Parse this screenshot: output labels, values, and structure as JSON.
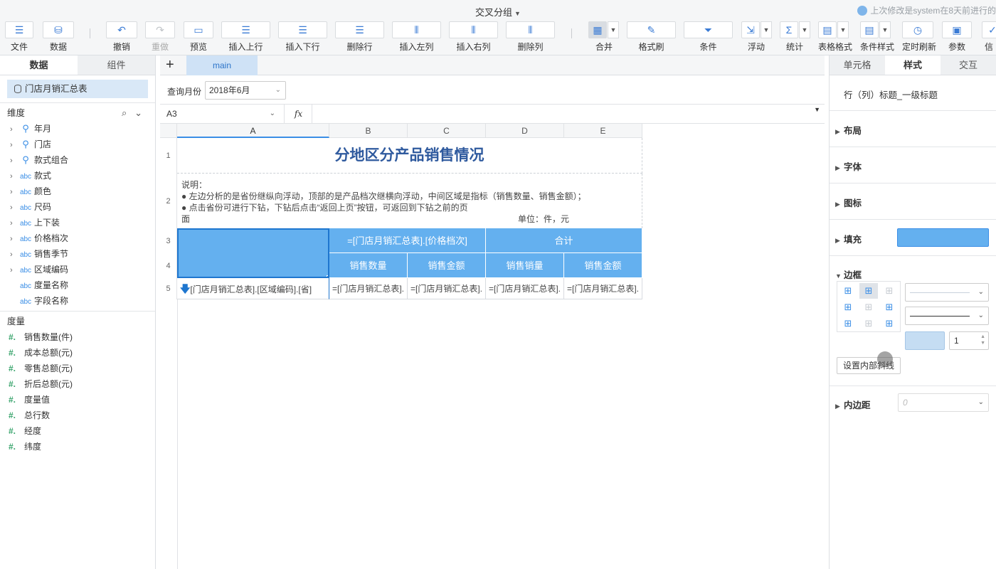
{
  "window": {
    "title": "交叉分组",
    "last_modified": "上次修改是system在8天前进行的"
  },
  "toolbar": {
    "file": "文件",
    "data": "数据",
    "undo": "撤销",
    "redo": "重做",
    "preview": "预览",
    "insert_row_above": "插入上行",
    "insert_row_below": "插入下行",
    "delete_row": "删除行",
    "insert_col_left": "插入左列",
    "insert_col_right": "插入右列",
    "delete_col": "删除列",
    "merge": "合并",
    "format_painter": "格式刷",
    "condition": "条件",
    "float": "浮动",
    "stats": "统计",
    "table_format": "表格格式",
    "cond_style": "条件样式",
    "timed_refresh": "定时刷新",
    "params": "参数",
    "more": "信"
  },
  "left_panel": {
    "tabs": [
      "数据",
      "组件"
    ],
    "dataset": "门店月销汇总表",
    "dimension_title": "维度",
    "dimensions": [
      {
        "label": "年月",
        "type": "pin"
      },
      {
        "label": "门店",
        "type": "pin"
      },
      {
        "label": "款式组合",
        "type": "pin"
      },
      {
        "label": "款式",
        "type": "abc"
      },
      {
        "label": "颜色",
        "type": "abc"
      },
      {
        "label": "尺码",
        "type": "abc"
      },
      {
        "label": "上下装",
        "type": "abc"
      },
      {
        "label": "价格档次",
        "type": "abc"
      },
      {
        "label": "销售季节",
        "type": "abc"
      },
      {
        "label": "区域编码",
        "type": "abc"
      },
      {
        "label": "度量名称",
        "type": "abc"
      },
      {
        "label": "字段名称",
        "type": "abc"
      }
    ],
    "measure_title": "度量",
    "measures": [
      "销售数量(件)",
      "成本总额(元)",
      "零售总额(元)",
      "折后总额(元)",
      "度量值",
      "总行数",
      "经度",
      "纬度"
    ]
  },
  "center": {
    "sheet_tab": "main",
    "param_label": "查询月份",
    "param_value": "2018年6月",
    "cell_ref": "A3",
    "fx": "fx",
    "columns": [
      "A",
      "B",
      "C",
      "D",
      "E"
    ],
    "rows": [
      "1",
      "2",
      "3",
      "4",
      "5"
    ],
    "report_title": "分地区分产品销售情况",
    "note_lines": [
      "说明：",
      "● 左边分析的是省份继纵向浮动，顶部的是产品档次继横向浮动，中间区域是指标（销售数量、销售金额）；",
      "● 点击省份可进行下钻，下钻后点击“返回上页”按钮，可返回到下钻之前的页",
      "面"
    ],
    "unit": "单位：件，元",
    "header_bc3": "=[门店月销汇总表].[价格档次]",
    "header_de3": "合计",
    "header_b4": "销售数量",
    "header_c4": "销售金额",
    "header_d4": "销售销量",
    "header_e4": "销售金额",
    "cell_a5": "[门店月销汇总表].[区域编码].[省]",
    "cell_b5": "=[门店月销汇总表].",
    "cell_c5": "=[门店月销汇总表].",
    "cell_d5": "=[门店月销汇总表].",
    "cell_e5": "=[门店月销汇总表]."
  },
  "right_panel": {
    "tabs": [
      "单元格",
      "样式",
      "交互"
    ],
    "style_name": "行（列）标题_一级标题",
    "sections": {
      "layout": "布局",
      "font": "字体",
      "icon": "图标",
      "fill": "填充",
      "border": "边框",
      "padding": "内边距"
    },
    "fill_color": "#64b0ef",
    "border_color": "#c5ddf3",
    "border_width": "1",
    "diag_button": "设置内部斜线",
    "padding_value": "0"
  }
}
